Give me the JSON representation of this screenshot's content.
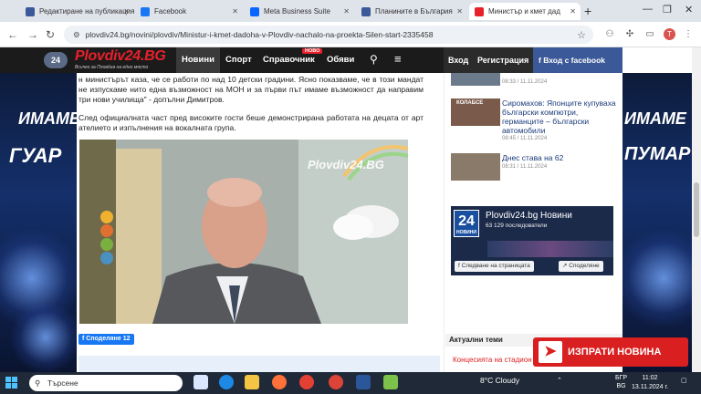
{
  "browser": {
    "tabs": [
      {
        "label": "Редактиране на публикация",
        "favicon_color": "#3b5998",
        "active": false
      },
      {
        "label": "Facebook",
        "favicon_color": "#1877f2",
        "active": false
      },
      {
        "label": "Meta Business Suite",
        "favicon_color": "#0866ff",
        "active": false
      },
      {
        "label": "Планините в България",
        "favicon_color": "#3b5998",
        "active": false
      },
      {
        "label": "Министър и кмет дад",
        "favicon_color": "#e8202a",
        "active": true
      }
    ],
    "url": "plovdiv24.bg/novini/plovdiv/Ministur-i-kmet-dadoha-v-Plovdiv-nachalo-na-proekta-Silen-start-2335458",
    "profile_initial": "T"
  },
  "site": {
    "badge": "24",
    "logo_text": "Plovdiv24.BG",
    "logo_tagline": "Всичко за Пловдив на едно място",
    "nav": [
      "Новини",
      "Спорт",
      "Справочник",
      "Обяви"
    ],
    "novo_badge": "НОВО",
    "login": "Вход",
    "register": "Регистрация",
    "fb_login": "Вход с facebook"
  },
  "ads": {
    "left_text": "ИМАМЕ",
    "left_text2": "ГУАР",
    "right_text": "ИМАМЕ",
    "right_text2": "ПУМАР"
  },
  "article": {
    "paragraph1": "н министърът каза, че се работи по над 10 детски градини. Ясно показваме, че в този мандат не изпускаме нито една възможност на МОН и за първи път имаме възможност да направим три нови училища\" - допълни Димитров.",
    "paragraph2": "След официалната част пред високите гости беше демонстрирана работата на децата от арт ателието и изпълнения на вокалната група.",
    "video_watermark": "Plovdiv24.BG",
    "share_label": "Споделяне",
    "share_count": "12"
  },
  "sidebar": {
    "items": [
      {
        "title": "",
        "meta": "08:33 / 11.11.2024",
        "thumb_color": "#6b7b8c"
      },
      {
        "title": "Сиромахов: Японците купуваха български компютри, германците – български автомобили",
        "meta": "08:45 / 11.11.2024",
        "thumb_color": "#7a5a4a",
        "thumb_label": "КОЛАБСЕ"
      },
      {
        "title": "Днес става на 62",
        "meta": "08:31 / 11.11.2024",
        "thumb_color": "#8a7a6a"
      }
    ],
    "fb_widget": {
      "badge": "24",
      "badge_sub": "НОВИНИ",
      "name": "Plovdiv24.bg Новини",
      "followers": "63 129 последователи",
      "follow_btn": "Следване на страницата",
      "share_btn": "Споделяне"
    },
    "topics_heading": "Актуални теми",
    "topic_link": "Концесията на стадион",
    "send_news": "ИЗПРАТИ НОВИНА"
  },
  "taskbar": {
    "search_placeholder": "Търсене",
    "weather": "8°C  Cloudy",
    "lang": "БГР",
    "lang2": "BG",
    "time": "11:02",
    "date": "13.11.2024 г."
  }
}
